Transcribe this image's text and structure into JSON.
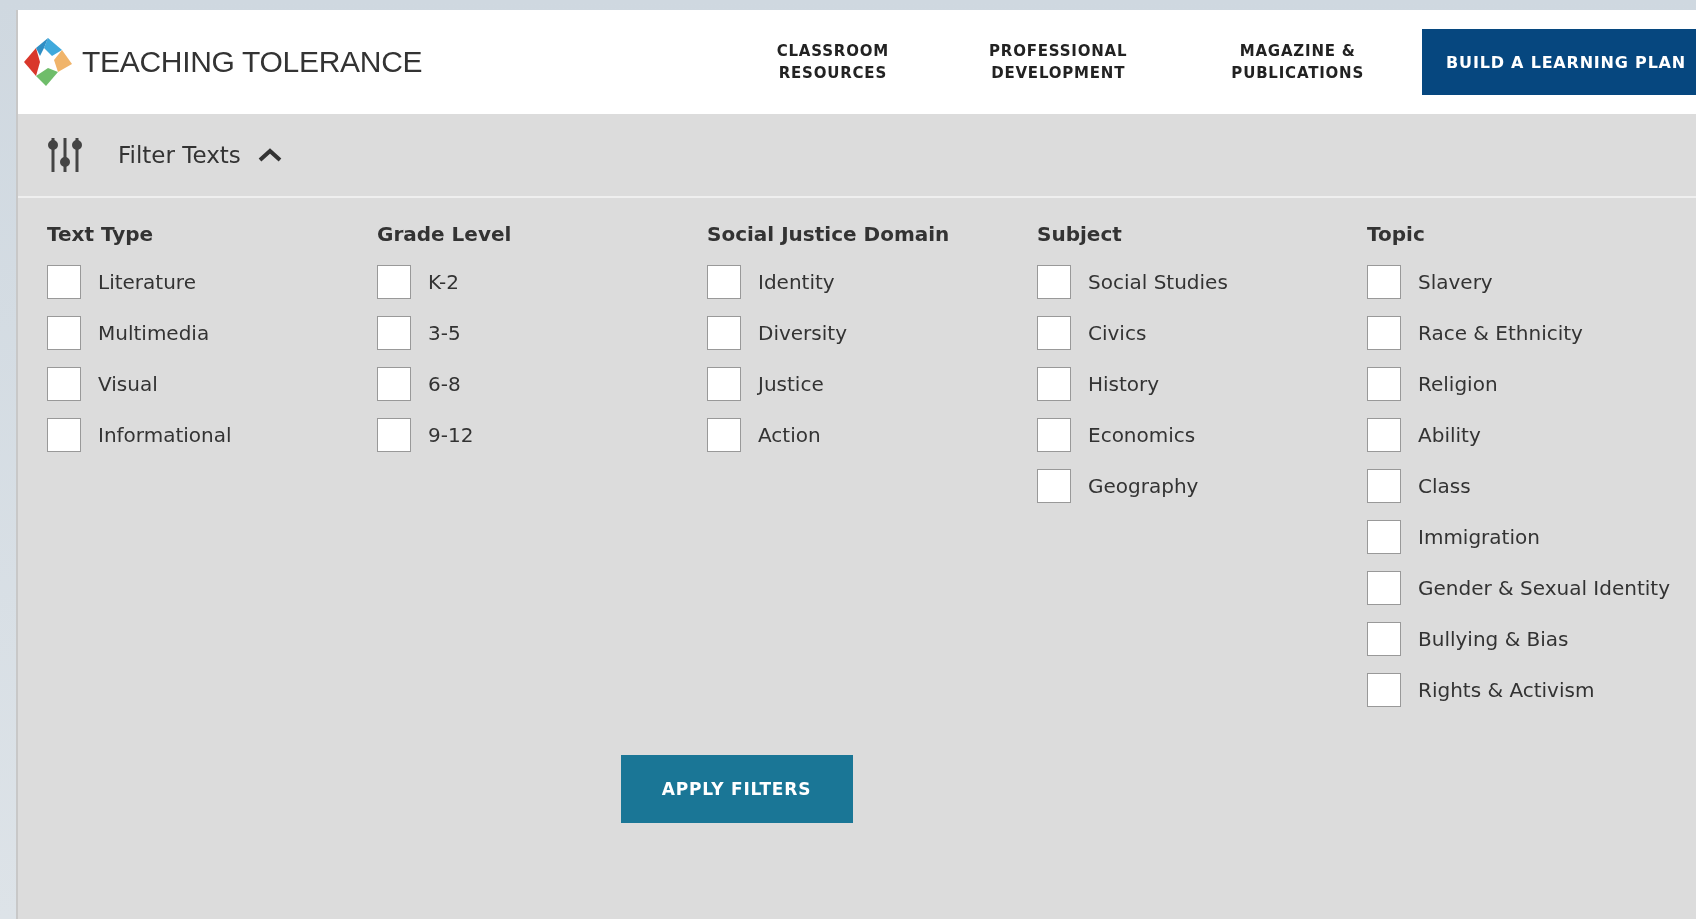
{
  "header": {
    "logo_text": "TEACHING TOLERANCE",
    "nav": [
      {
        "lines": [
          "CLASSROOM",
          "RESOURCES"
        ]
      },
      {
        "lines": [
          "PROFESSIONAL",
          "DEVELOPMENT"
        ]
      },
      {
        "lines": [
          "MAGAZINE &",
          "PUBLICATIONS"
        ]
      }
    ],
    "cta": "BUILD A LEARNING PLAN"
  },
  "filter_bar": {
    "title": "Filter Texts",
    "expanded": true
  },
  "filter_groups": [
    {
      "heading": "Text Type",
      "options": [
        {
          "label": "Literature",
          "checked": false
        },
        {
          "label": "Multimedia",
          "checked": false
        },
        {
          "label": "Visual",
          "checked": false
        },
        {
          "label": "Informational",
          "checked": false
        }
      ]
    },
    {
      "heading": "Grade Level",
      "options": [
        {
          "label": "K-2",
          "checked": false
        },
        {
          "label": "3-5",
          "checked": false
        },
        {
          "label": "6-8",
          "checked": false
        },
        {
          "label": "9-12",
          "checked": false
        }
      ]
    },
    {
      "heading": "Social Justice Domain",
      "options": [
        {
          "label": "Identity",
          "checked": false
        },
        {
          "label": "Diversity",
          "checked": false
        },
        {
          "label": "Justice",
          "checked": false
        },
        {
          "label": "Action",
          "checked": false
        }
      ]
    },
    {
      "heading": "Subject",
      "options": [
        {
          "label": "Social Studies",
          "checked": false
        },
        {
          "label": "Civics",
          "checked": false
        },
        {
          "label": "History",
          "checked": false
        },
        {
          "label": "Economics",
          "checked": false
        },
        {
          "label": "Geography",
          "checked": false
        }
      ]
    },
    {
      "heading": "Topic",
      "options": [
        {
          "label": "Slavery",
          "checked": false
        },
        {
          "label": "Race & Ethnicity",
          "checked": false
        },
        {
          "label": "Religion",
          "checked": false
        },
        {
          "label": "Ability",
          "checked": false
        },
        {
          "label": "Class",
          "checked": false
        },
        {
          "label": "Immigration",
          "checked": false
        },
        {
          "label": "Gender & Sexual Identity",
          "checked": false
        },
        {
          "label": "Bullying & Bias",
          "checked": false
        },
        {
          "label": "Rights & Activism",
          "checked": false
        }
      ]
    }
  ],
  "apply_button": "APPLY FILTERS"
}
